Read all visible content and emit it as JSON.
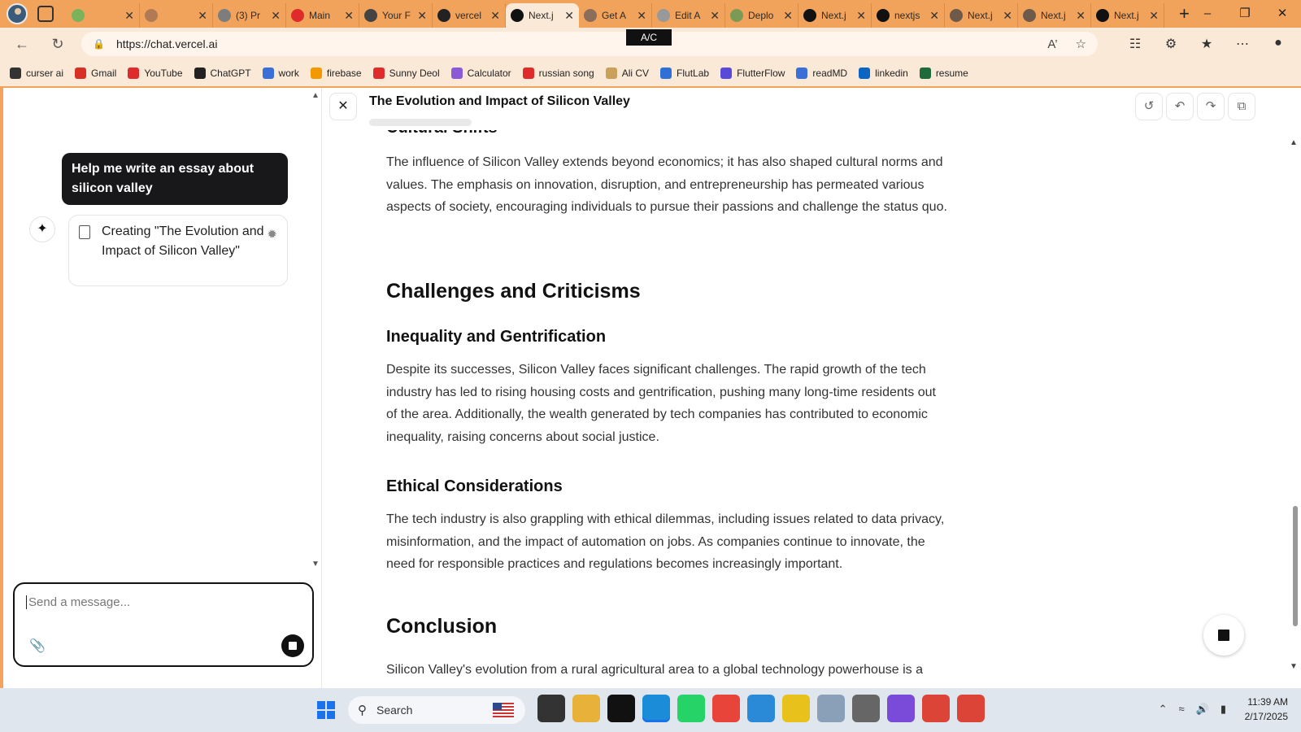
{
  "browser": {
    "tabs": [
      {
        "title": "",
        "fav": "hammer-icon",
        "color": "#7bb35b"
      },
      {
        "title": "",
        "fav": "circle-icon",
        "color": "#b07a55"
      },
      {
        "title": "(3) Pr",
        "fav": "linkedin-icon",
        "color": "#7d7d7d"
      },
      {
        "title": "Main",
        "fav": "youtube-icon",
        "color": "#e02b2b"
      },
      {
        "title": "Your F",
        "fav": "github-icon",
        "color": "#444"
      },
      {
        "title": "vercel",
        "fav": "github-icon",
        "color": "#222"
      },
      {
        "title": "Next.j",
        "fav": "nextjs-icon",
        "color": "#111"
      },
      {
        "title": "Get A",
        "fav": "git-icon",
        "color": "#8a6d5a"
      },
      {
        "title": "Edit A",
        "fav": "edit-icon",
        "color": "#999"
      },
      {
        "title": "Deplo",
        "fav": "leaf-icon",
        "color": "#7a9a55"
      },
      {
        "title": "Next.j",
        "fav": "nextjs-icon",
        "color": "#111"
      },
      {
        "title": "nextjs",
        "fav": "vercel-icon",
        "color": "#111"
      },
      {
        "title": "Next.j",
        "fav": "nextjs-icon",
        "color": "#6d5a4a"
      },
      {
        "title": "Next.j",
        "fav": "nextjs-icon",
        "color": "#6d5a4a"
      },
      {
        "title": "Next.j",
        "fav": "nextjs-icon",
        "color": "#111"
      }
    ],
    "url": "https://chat.vercel.ai",
    "tooltip": "A/C",
    "bookmarks": [
      {
        "label": "curser ai",
        "color": "#333"
      },
      {
        "label": "Gmail",
        "color": "#d93025"
      },
      {
        "label": "YouTube",
        "color": "#e02b2b"
      },
      {
        "label": "ChatGPT",
        "color": "#222"
      },
      {
        "label": "work",
        "color": "#3b6fd8"
      },
      {
        "label": "firebase",
        "color": "#f29900"
      },
      {
        "label": "Sunny Deol",
        "color": "#e02b2b"
      },
      {
        "label": "Calculator",
        "color": "#8a5ad8"
      },
      {
        "label": "russian song",
        "color": "#e02b2b"
      },
      {
        "label": "Ali CV",
        "color": "#caa15a"
      },
      {
        "label": "FlutLab",
        "color": "#2f6fd8"
      },
      {
        "label": "FlutterFlow",
        "color": "#5a4ad8"
      },
      {
        "label": "readMD",
        "color": "#3b6fd8"
      },
      {
        "label": "linkedin",
        "color": "#0a66c2"
      },
      {
        "label": "resume",
        "color": "#1d6b3a"
      }
    ]
  },
  "chat": {
    "user_message": "Help me write an essay about silicon valley",
    "artifact_status": "Creating \"The Evolution and Impact of Silicon Valley\"",
    "input_placeholder": "Send a message..."
  },
  "artifact": {
    "title": "The Evolution and Impact of Silicon Valley",
    "cutoff_heading": "Cultural Shifts",
    "p_cultural": "The influence of Silicon Valley extends beyond economics; it has also shaped cultural norms and values. The emphasis on innovation, disruption, and entrepreneurship has permeated various aspects of society, encouraging individuals to pursue their passions and challenge the status quo.",
    "h_challenges": "Challenges and Criticisms",
    "h_inequality": "Inequality and Gentrification",
    "p_inequality": "Despite its successes, Silicon Valley faces significant challenges. The rapid growth of the tech industry has led to rising housing costs and gentrification, pushing many long-time residents out of the area. Additionally, the wealth generated by tech companies has contributed to economic inequality, raising concerns about social justice.",
    "h_ethics": "Ethical Considerations",
    "p_ethics": "The tech industry is also grappling with ethical dilemmas, including issues related to data privacy, misinformation, and the impact of automation on jobs. As companies continue to innovate, the need for responsible practices and regulations becomes increasingly important.",
    "h_conclusion": "Conclusion",
    "p_conclusion": "Silicon Valley's evolution from a rural agricultural area to a global technology powerhouse is a"
  },
  "taskbar": {
    "search_label": "Search",
    "apps": [
      {
        "name": "file-explorer-icon",
        "color": "#333"
      },
      {
        "name": "folder-icon",
        "color": "#e8b23a"
      },
      {
        "name": "capcut-icon",
        "color": "#111"
      },
      {
        "name": "edge-icon",
        "color": "#1a8cd8"
      },
      {
        "name": "whatsapp-icon",
        "color": "#25d366"
      },
      {
        "name": "anydesk-icon",
        "color": "#e8443a"
      },
      {
        "name": "vscode-icon",
        "color": "#2a8ad8"
      },
      {
        "name": "app-icon",
        "color": "#e8c21a"
      },
      {
        "name": "chart-app-icon",
        "color": "#8aa0b8"
      },
      {
        "name": "clock-app-icon",
        "color": "#666"
      },
      {
        "name": "visual-studio-icon",
        "color": "#7a4ad8"
      },
      {
        "name": "chrome-icon",
        "color": "#db4437"
      },
      {
        "name": "chrome-icon",
        "color": "#db4437"
      }
    ],
    "time": "11:39 AM",
    "date": "2/17/2025"
  }
}
